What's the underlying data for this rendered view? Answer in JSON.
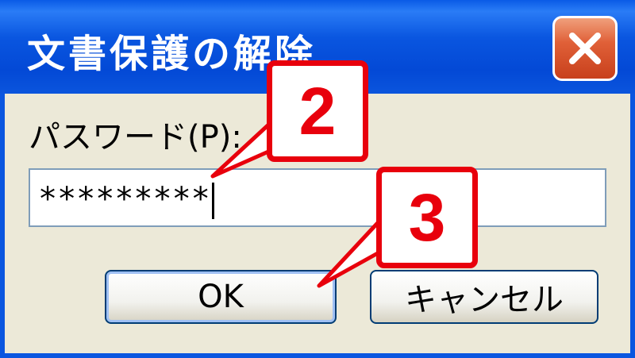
{
  "dialog": {
    "title": "文書保護の解除",
    "password_label": "パスワード(P):",
    "password_value": "*********",
    "ok_label": "OK",
    "cancel_label": "キャンセル"
  },
  "callouts": {
    "step2": "2",
    "step3": "3"
  },
  "colors": {
    "titlebar": "#0a56e0",
    "close_button": "#e06038",
    "callout": "#e8000c",
    "dialog_bg": "#ece9d8"
  }
}
